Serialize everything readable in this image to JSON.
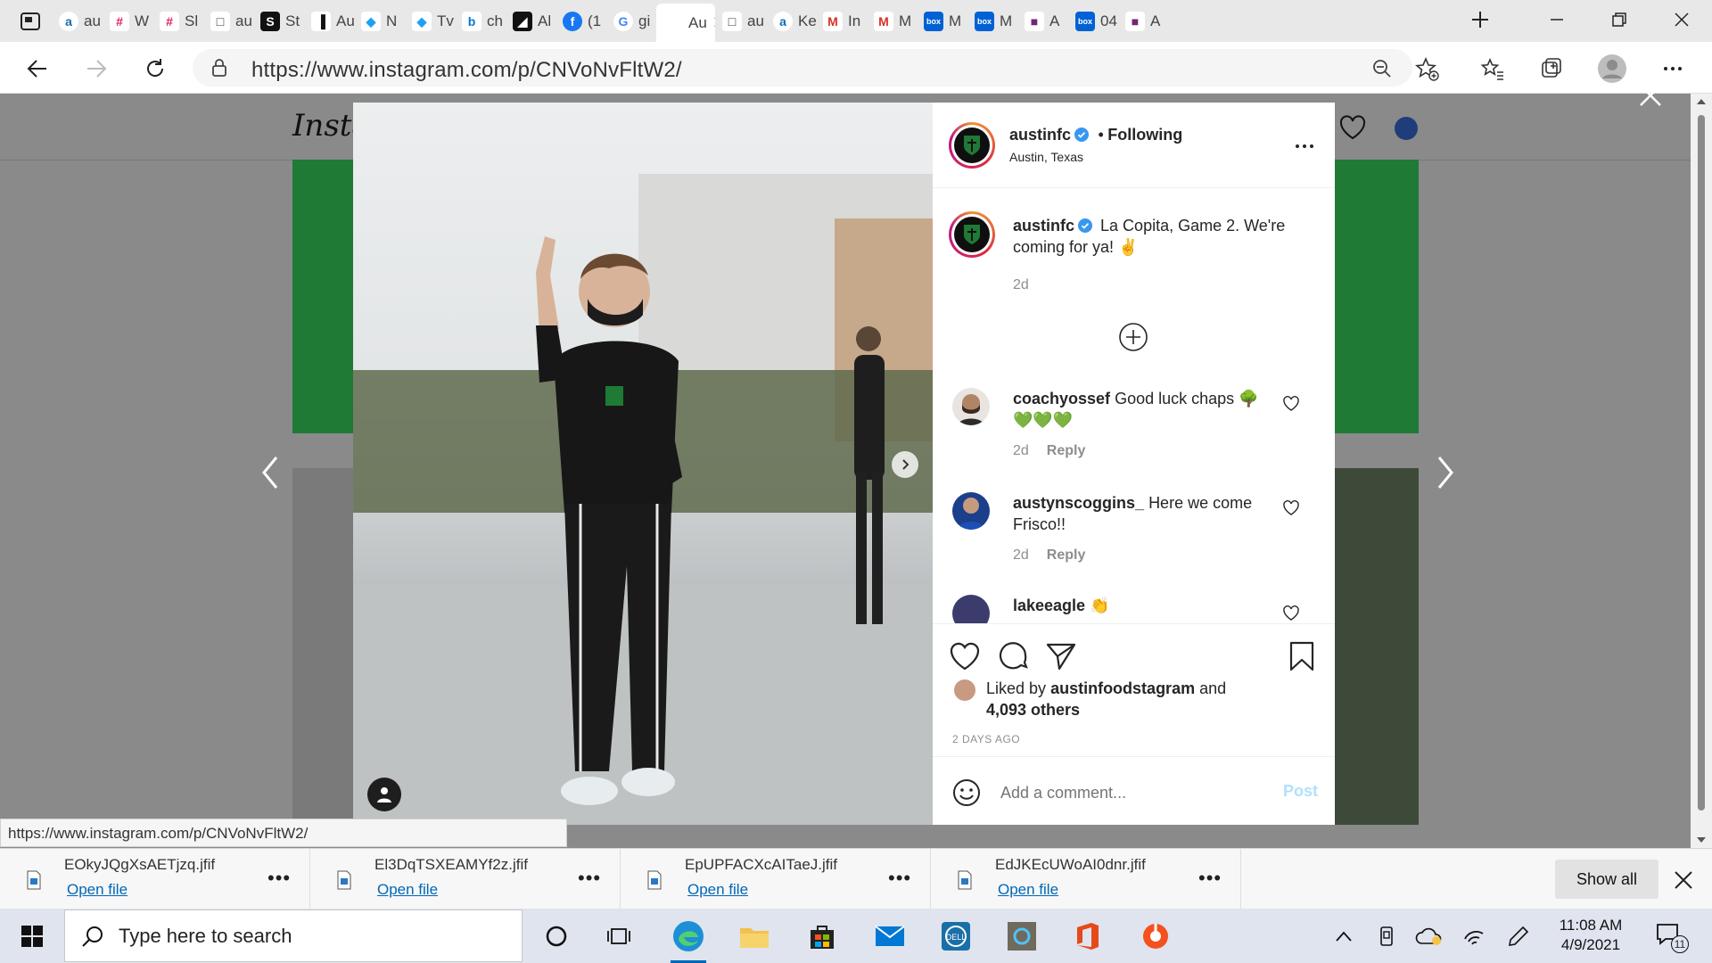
{
  "browser": {
    "tabs": [
      {
        "icon": "amazon-icon",
        "title": "au",
        "color": "#ffffff"
      },
      {
        "icon": "slack-icon",
        "title": "W",
        "color": "#ffffff"
      },
      {
        "icon": "slack-icon",
        "title": "Sl",
        "color": "#4a154b"
      },
      {
        "icon": "document-icon",
        "title": "au",
        "color": "#ffffff"
      },
      {
        "icon": "s-icon",
        "title": "St",
        "color": "#111111"
      },
      {
        "icon": "news-icon",
        "title": "Au",
        "color": "#ffffff"
      },
      {
        "icon": "twitter-icon",
        "title": "N",
        "color": "#ffffff"
      },
      {
        "icon": "twitter-icon",
        "title": "Tv",
        "color": "#ffffff"
      },
      {
        "icon": "bing-icon",
        "title": "ch",
        "color": "#ffffff"
      },
      {
        "icon": "austin-fc-icon",
        "title": "Al",
        "color": "#111111"
      },
      {
        "icon": "facebook-icon",
        "title": "(1",
        "color": "#1877f2"
      },
      {
        "icon": "google-icon",
        "title": "gi",
        "color": "#ffffff"
      },
      {
        "icon": "instagram-icon",
        "title": "Au",
        "color": "#ffffff",
        "active": true
      },
      {
        "icon": "document-icon",
        "title": "au",
        "color": "#ffffff"
      },
      {
        "icon": "amazon-icon",
        "title": "Ke",
        "color": "#ffffff"
      },
      {
        "icon": "gmail-icon",
        "title": "In",
        "color": "#ffffff"
      },
      {
        "icon": "gmail-icon",
        "title": "M",
        "color": "#ffffff"
      },
      {
        "icon": "box-icon",
        "title": "M",
        "color": "#0061d5"
      },
      {
        "icon": "box-icon",
        "title": "M",
        "color": "#0061d5"
      },
      {
        "icon": "powerapps-icon",
        "title": "A",
        "color": "#ffffff"
      },
      {
        "icon": "box-icon",
        "title": "04",
        "color": "#0061d5"
      },
      {
        "icon": "powerapps-icon",
        "title": "A",
        "color": "#ffffff"
      }
    ],
    "url": "https://www.instagram.com/p/CNVoNvFltW2/",
    "status_url": "https://www.instagram.com/p/CNVoNvFltW2/"
  },
  "post": {
    "username": "austinfc",
    "following_label": "Following",
    "location": "Austin, Texas",
    "caption": "La Copita, Game 2. We're coming for ya! ✌",
    "caption_age": "2d",
    "comments": [
      {
        "username": "coachyossef",
        "text": "Good luck chaps 🌳 💚💚💚",
        "age": "2d",
        "reply": "Reply"
      },
      {
        "username": "austynscoggins_",
        "text": "Here we come Frisco!!",
        "age": "2d",
        "reply": "Reply"
      },
      {
        "username": "lakeeagle",
        "text": "👏"
      }
    ],
    "liked_by_prefix": "Liked by",
    "liked_by_user": "austinfoodstagram",
    "liked_by_and": "and",
    "likes_others": "4,093 others",
    "post_age": "2 DAYS AGO",
    "comment_placeholder": "Add a comment...",
    "post_label": "Post"
  },
  "background_page": {
    "logo_partial": "Insta"
  },
  "downloads": [
    {
      "file": "EOkyJQgXsAETjzq.jfif",
      "action": "Open file"
    },
    {
      "file": "El3DqTSXEAMYf2z.jfif",
      "action": "Open file"
    },
    {
      "file": "EpUPFACXcAITaeJ.jfif",
      "action": "Open file"
    },
    {
      "file": "EdJKEcUWoAI0dnr.jfif",
      "action": "Open file"
    }
  ],
  "downloads_bar": {
    "show_all": "Show all"
  },
  "taskbar": {
    "search_placeholder": "Type here to search",
    "time": "11:08 AM",
    "date": "4/9/2021",
    "notification_count": "11"
  },
  "colors": {
    "accent": "#0067b8",
    "instagram_link": "#0095f6",
    "austin_green": "#1f7a35"
  }
}
